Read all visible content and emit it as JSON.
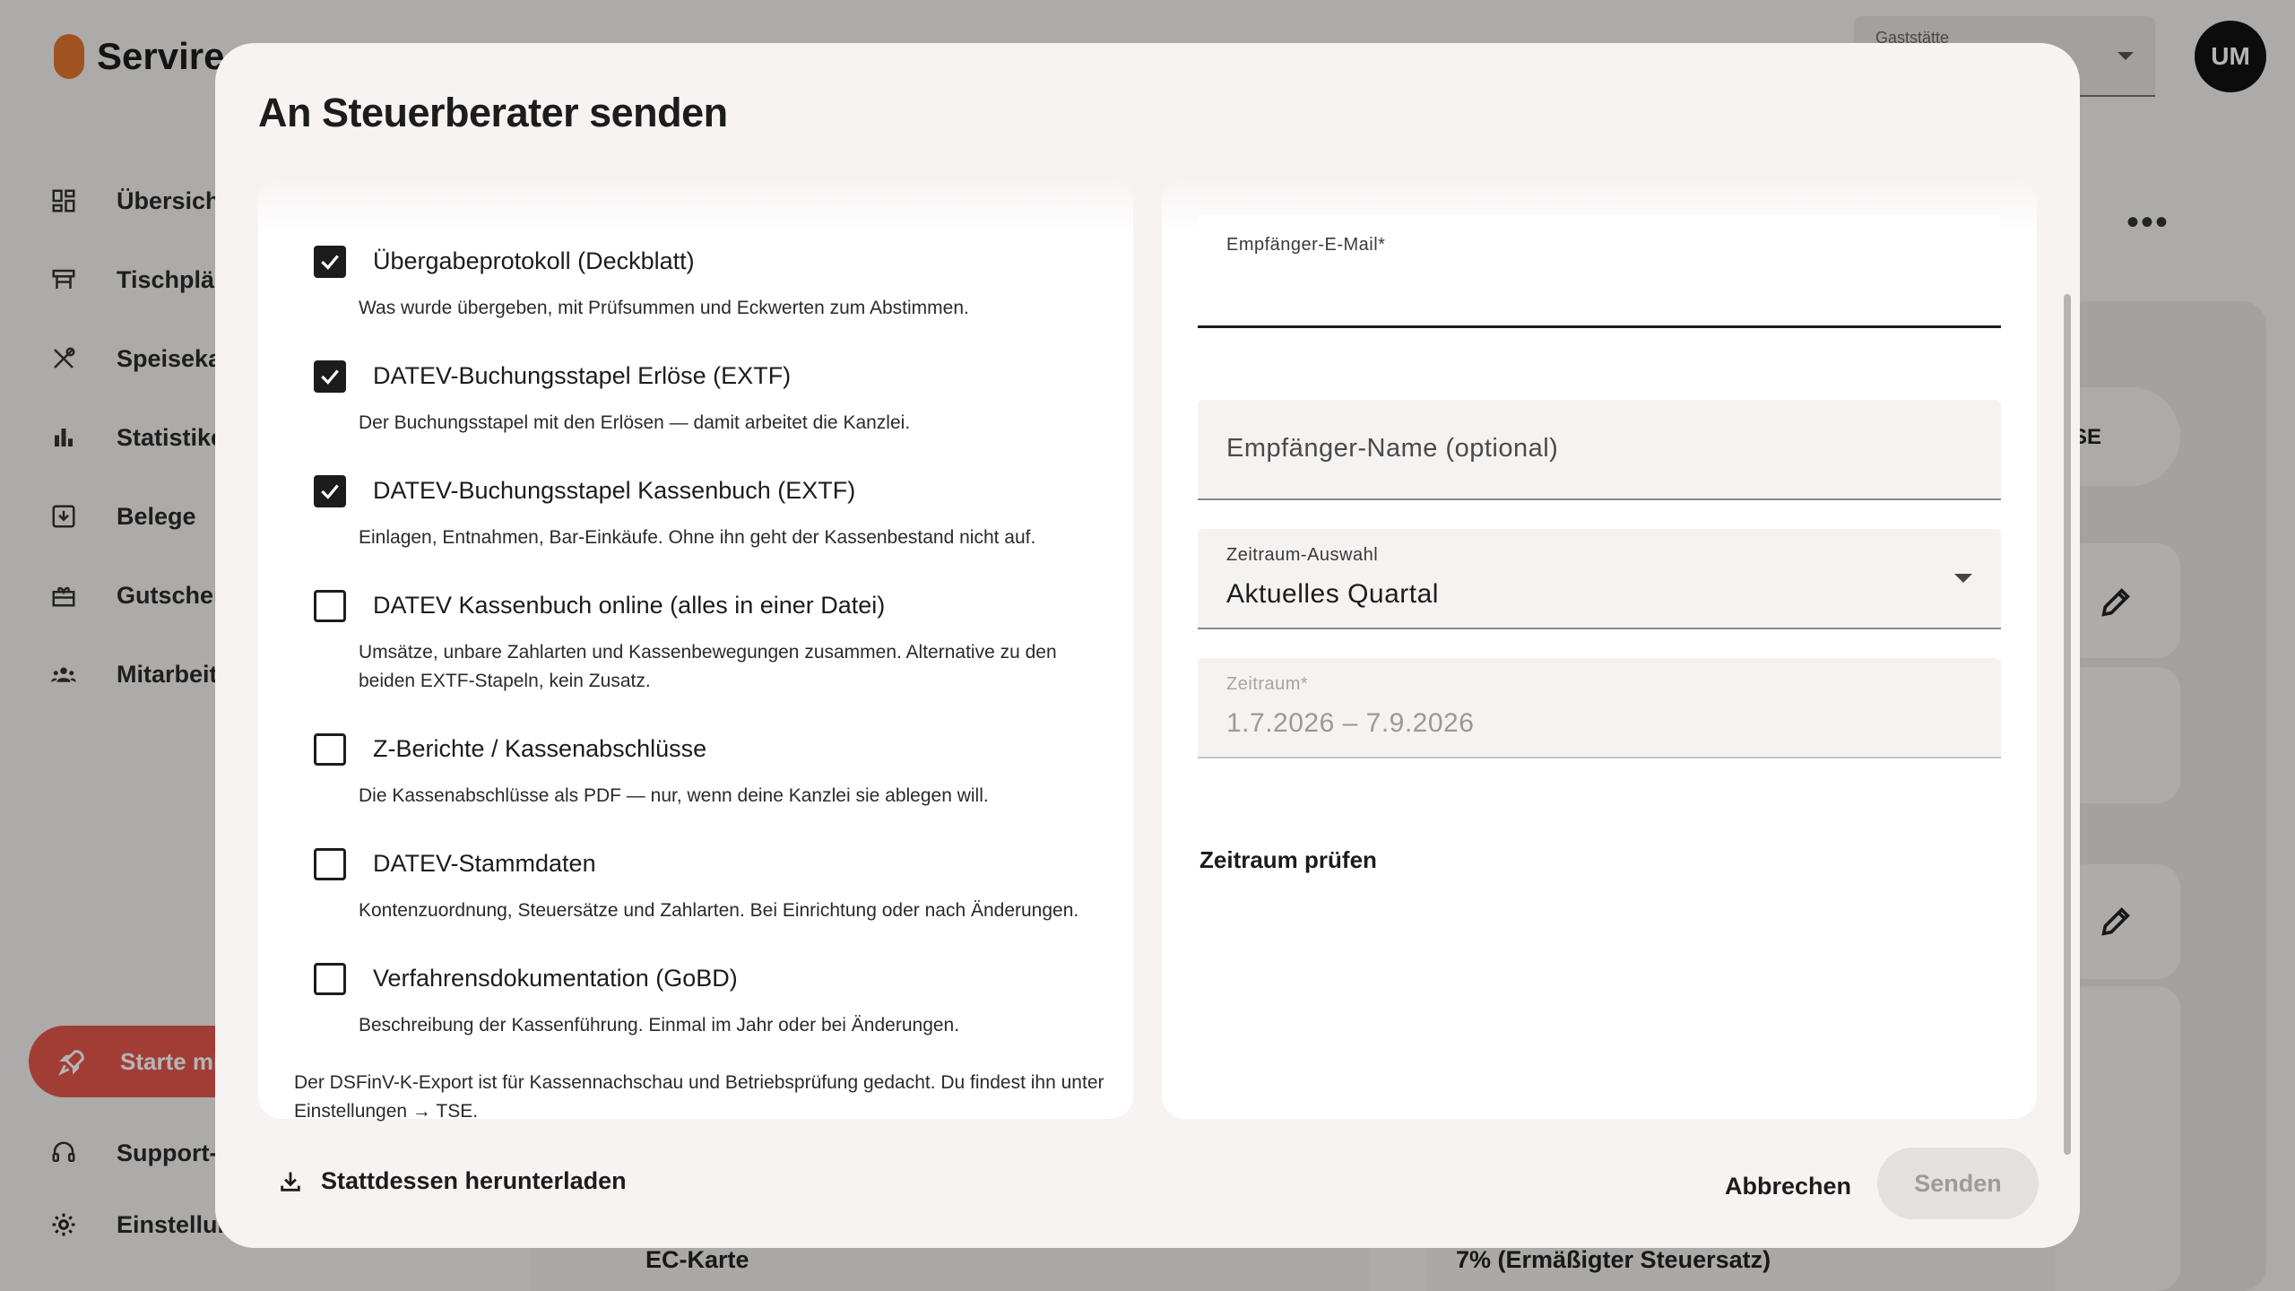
{
  "app": {
    "brand": "Servire",
    "nav": [
      {
        "label": "Übersicht",
        "icon": "dashboard-icon"
      },
      {
        "label": "Tischpläne",
        "icon": "table-icon"
      },
      {
        "label": "Speisekarte",
        "icon": "cutlery-icon"
      },
      {
        "label": "Statistiken",
        "icon": "bar-chart-icon"
      },
      {
        "label": "Belege",
        "icon": "receipt-download-icon"
      },
      {
        "label": "Gutscheine",
        "icon": "gift-icon"
      },
      {
        "label": "Mitarbeiter",
        "icon": "team-icon"
      }
    ],
    "start_label": "Starte mit Servire",
    "support_label": "Support-Center",
    "settings_label": "Einstellungen",
    "venue_label": "Gaststätte",
    "avatar_initials": "UM",
    "pill_text": "SE",
    "bottom_left_text": "EC-Karte",
    "bottom_right_text": "7% (Ermäßigter Steuersatz)"
  },
  "dialog": {
    "title": "An Steuerberater senden",
    "options": [
      {
        "label": "Übergabeprotokoll (Deckblatt)",
        "desc": "Was wurde übergeben, mit Prüfsummen und Eckwerten zum Abstimmen.",
        "checked": true
      },
      {
        "label": "DATEV-Buchungsstapel Erlöse (EXTF)",
        "desc": "Der Buchungsstapel mit den Erlösen — damit arbeitet die Kanzlei.",
        "checked": true
      },
      {
        "label": "DATEV-Buchungsstapel Kassenbuch (EXTF)",
        "desc": "Einlagen, Entnahmen, Bar-Einkäufe. Ohne ihn geht der Kassenbestand nicht auf.",
        "checked": true
      },
      {
        "label": "DATEV Kassenbuch online (alles in einer Datei)",
        "desc": "Umsätze, unbare Zahlarten und Kassenbewegungen zusammen. Alternative zu den beiden EXTF-Stapeln, kein Zusatz.",
        "checked": false
      },
      {
        "label": "Z-Berichte / Kassenabschlüsse",
        "desc": "Die Kassenabschlüsse als PDF — nur, wenn deine Kanzlei sie ablegen will.",
        "checked": false
      },
      {
        "label": "DATEV-Stammdaten",
        "desc": "Kontenzuordnung, Steuersätze und Zahlarten. Bei Einrichtung oder nach Änderungen.",
        "checked": false
      },
      {
        "label": "Verfahrensdokumentation (GoBD)",
        "desc": "Beschreibung der Kassenführung. Einmal im Jahr oder bei Änderungen.",
        "checked": false
      }
    ],
    "note": "Der DSFinV-K-Export ist für Kassennachschau und Betriebsprüfung gedacht. Du findest ihn unter Einstellungen → TSE.",
    "email_label": "Empfänger-E-Mail*",
    "email_value": "",
    "name_placeholder": "Empfänger-Name (optional)",
    "period_select_label": "Zeitraum-Auswahl",
    "period_select_value": "Aktuelles Quartal",
    "period_label": "Zeitraum*",
    "period_value": "1.7.2026 – 7.9.2026",
    "check_period_label": "Zeitraum prüfen",
    "download_label": "Stattdessen herunterladen",
    "cancel_label": "Abbrechen",
    "send_label": "Senden"
  }
}
